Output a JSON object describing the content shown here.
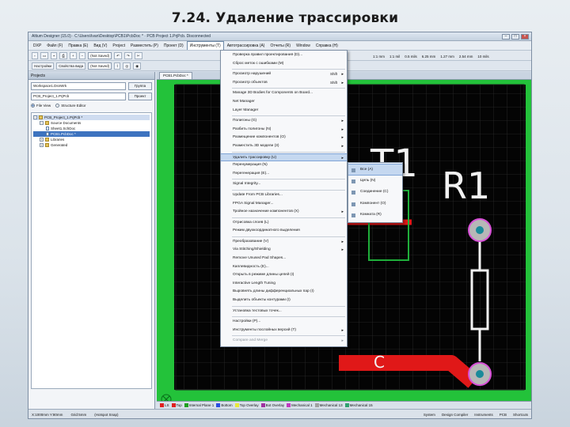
{
  "slide_title": "7.24. Удаление трассировки",
  "window": {
    "title": "Altium Designer (15.0) · C:\\Users\\Ivan\\Desktop\\PCB1\\PcbDoc * · PCB Project 1.PrjPcb. Disconnected",
    "minimize": "–",
    "maximize": "□",
    "close": "×"
  },
  "menubar": [
    "DXP",
    "Файл (F)",
    "Правка (E)",
    "Вид (V)",
    "Project",
    "Разместить (P)",
    "Проект (D)",
    "Инструменты (T)",
    "Автотрассировка (A)",
    "Отчеты (R)",
    "Window",
    "Справка (H)"
  ],
  "toolbar1": {
    "select_value": "(Not Saved)",
    "right_items": [
      "1:1 mm",
      "1:1 mil",
      "0.5 mils",
      "6.25 mm",
      "1.27 mm",
      "2.54 mm",
      "10 mils"
    ]
  },
  "toolbar2": {
    "label": "Настройки",
    "view_label": "Свойства вида",
    "select_value": "(Not Saved)"
  },
  "panel": {
    "title": "Projects",
    "workspace_field": "Workspace1.DsnWrk",
    "workspace_btn": "Группа",
    "project_field": "PCB_Project_1.PrjPcb",
    "project_btn": "Проект",
    "radio_file_view": "File View",
    "radio_structure": "Structure Editor",
    "tree": [
      {
        "label": "PCB_Project_1.PrjPcb *",
        "kind": "folder",
        "expander": "−",
        "level": 0,
        "state": "hl"
      },
      {
        "label": "Source Documents",
        "kind": "folder",
        "expander": "−",
        "level": 1,
        "state": ""
      },
      {
        "label": "Sheet1.SchDoc",
        "kind": "doc",
        "expander": "",
        "level": 2,
        "state": ""
      },
      {
        "label": "PCB1.PcbDoc *",
        "kind": "doc",
        "expander": "",
        "level": 2,
        "state": "sel"
      },
      {
        "label": "Libraries",
        "kind": "folder",
        "expander": "+",
        "level": 1,
        "state": ""
      },
      {
        "label": "Generated",
        "kind": "folder",
        "expander": "+",
        "level": 1,
        "state": ""
      }
    ]
  },
  "doc_tab": "PCB1.PcbDoc *",
  "pcb": {
    "designators": [
      "T1",
      "R1"
    ],
    "partial_label": "C"
  },
  "tools_menu": [
    {
      "label": "Проверка правил проектирования (D)...",
      "shortcut": "",
      "submenu": false,
      "state": ""
    },
    {
      "label": "Сброс меток с ошибками (M)",
      "shortcut": "",
      "submenu": false,
      "state": ""
    },
    {
      "sep": true
    },
    {
      "label": "Просмотр нарушений",
      "shortcut": "Shift",
      "submenu": true,
      "state": ""
    },
    {
      "label": "Просмотр объектов",
      "shortcut": "Shift",
      "submenu": true,
      "state": ""
    },
    {
      "sep": true
    },
    {
      "label": "Manage 3D Bodies for Components on Board...",
      "shortcut": "",
      "submenu": false,
      "state": ""
    },
    {
      "label": "Net Manager",
      "shortcut": "",
      "submenu": false,
      "state": ""
    },
    {
      "label": "Layer Manager",
      "shortcut": "",
      "submenu": false,
      "state": ""
    },
    {
      "sep": true
    },
    {
      "label": "Полигоны (G)",
      "shortcut": "",
      "submenu": true,
      "state": ""
    },
    {
      "label": "Разбить полигоны (N)",
      "shortcut": "",
      "submenu": true,
      "state": ""
    },
    {
      "label": "Размещение компонентов (O)",
      "shortcut": "",
      "submenu": true,
      "state": ""
    },
    {
      "label": "Разместить 3D модели (3)",
      "shortcut": "",
      "submenu": true,
      "state": ""
    },
    {
      "sep": true
    },
    {
      "label": "Удалить трассировку (U)",
      "shortcut": "",
      "submenu": true,
      "state": "active"
    },
    {
      "label": "Перенумерация (N)",
      "shortcut": "",
      "submenu": false,
      "state": ""
    },
    {
      "label": "Перегенерация (Е)...",
      "shortcut": "",
      "submenu": false,
      "state": ""
    },
    {
      "sep": true
    },
    {
      "label": "Signal Integrity...",
      "shortcut": "",
      "submenu": false,
      "state": ""
    },
    {
      "sep": true
    },
    {
      "label": "Update From PCB Libraries...",
      "shortcut": "",
      "submenu": false,
      "state": ""
    },
    {
      "label": "FPGA Signal Manager...",
      "shortcut": "",
      "submenu": false,
      "state": ""
    },
    {
      "label": "Тройное назначение компонентов (Х)",
      "shortcut": "",
      "submenu": true,
      "state": ""
    },
    {
      "sep": true
    },
    {
      "label": "Отрисовка слоев (L)",
      "shortcut": "",
      "submenu": false,
      "state": ""
    },
    {
      "label": "Режим двухкоординатного выделения",
      "shortcut": "",
      "submenu": false,
      "state": ""
    },
    {
      "sep": true
    },
    {
      "label": "Преобразование (V)",
      "shortcut": "",
      "submenu": true,
      "state": ""
    },
    {
      "label": "Via Stitching/Shielding",
      "shortcut": "",
      "submenu": true,
      "state": ""
    },
    {
      "label": "Remove Unused Pad Shapes...",
      "shortcut": "",
      "submenu": false,
      "state": ""
    },
    {
      "label": "Каплевидность (Е)...",
      "shortcut": "",
      "submenu": false,
      "state": ""
    },
    {
      "label": "Открыть в режиме длины цепей (I)",
      "shortcut": "",
      "submenu": false,
      "state": ""
    },
    {
      "label": "Interactive Length Tuning",
      "shortcut": "",
      "submenu": false,
      "state": ""
    },
    {
      "label": "Выровнять длины дифференциальных пар (I)",
      "shortcut": "",
      "submenu": false,
      "state": ""
    },
    {
      "label": "Выделить объекты контурами (I)",
      "shortcut": "",
      "submenu": false,
      "state": ""
    },
    {
      "sep": true
    },
    {
      "label": "Установка тестовых точек...",
      "shortcut": "",
      "submenu": false,
      "state": ""
    },
    {
      "sep": true
    },
    {
      "label": "Настройки (P)...",
      "shortcut": "",
      "submenu": false,
      "state": ""
    },
    {
      "label": "Инструменты послойных версий (Т)",
      "shortcut": "",
      "submenu": true,
      "state": ""
    },
    {
      "sep": true
    },
    {
      "label": "Compare and Merge",
      "shortcut": "",
      "submenu": true,
      "state": "disabled"
    }
  ],
  "unroute_submenu": [
    {
      "label": "Все (А)",
      "state": "active"
    },
    {
      "label": "Цепь (N)",
      "state": ""
    },
    {
      "label": "Соединение (С)",
      "state": ""
    },
    {
      "label": "Компонент (O)",
      "state": ""
    },
    {
      "label": "Комната (R)",
      "state": ""
    }
  ],
  "layer_tabs": [
    {
      "label": "LS",
      "color": "#e02020"
    },
    {
      "label": "Top",
      "color": "#e02020"
    },
    {
      "label": "Internal Plane 1",
      "color": "#1f9f1f"
    },
    {
      "label": "Bottom",
      "color": "#2a4ee0"
    },
    {
      "label": "Top Overlay",
      "color": "#e8e83a"
    },
    {
      "label": "Bot Overlay",
      "color": "#a030a0"
    },
    {
      "label": "Mechanical 1",
      "color": "#c03ac0"
    },
    {
      "label": "Mechanical 13",
      "color": "#a0a0a0"
    },
    {
      "label": "Mechanical 15",
      "color": "#30a070"
    }
  ],
  "statusbar": {
    "left": [
      "X:1000mm Y:80mm",
      "Grid:5mm",
      "(Hotspot Snap)"
    ],
    "right": [
      "System",
      "Design Compiler",
      "Instruments",
      "PCB",
      "Shortcuts"
    ]
  }
}
